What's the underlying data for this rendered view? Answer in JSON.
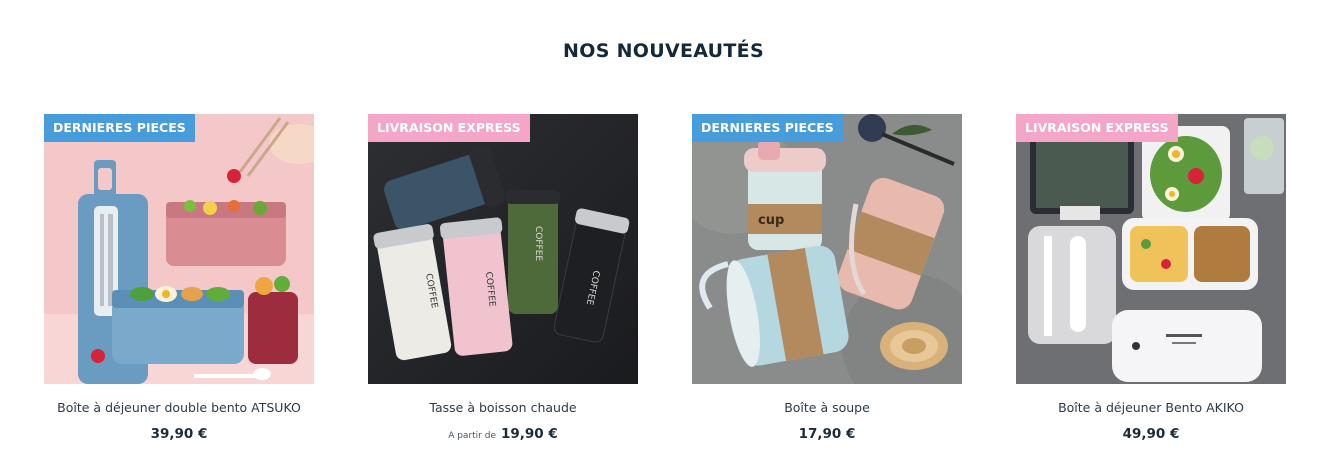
{
  "section": {
    "title": "NOS NOUVEAUTÉS"
  },
  "products": [
    {
      "badge": "DERNIERES PIECES",
      "badge_color": "#479cdc",
      "name": "Boîte à déjeuner double bento ATSUKO",
      "price_prefix": "",
      "price": "39,90 €"
    },
    {
      "badge": "LIVRAISON EXPRESS",
      "badge_color": "#f3a6c8",
      "name": "Tasse à boisson chaude",
      "price_prefix": "A partir de",
      "price": "19,90 €"
    },
    {
      "badge": "DERNIERES PIECES",
      "badge_color": "#479cdc",
      "name": "Boîte à soupe",
      "price_prefix": "",
      "price": "17,90 €"
    },
    {
      "badge": "LIVRAISON EXPRESS",
      "badge_color": "#f3a6c8",
      "name": "Boîte à déjeuner Bento AKIKO",
      "price_prefix": "",
      "price": "49,90 €"
    }
  ],
  "mug_text": "COFFEE"
}
